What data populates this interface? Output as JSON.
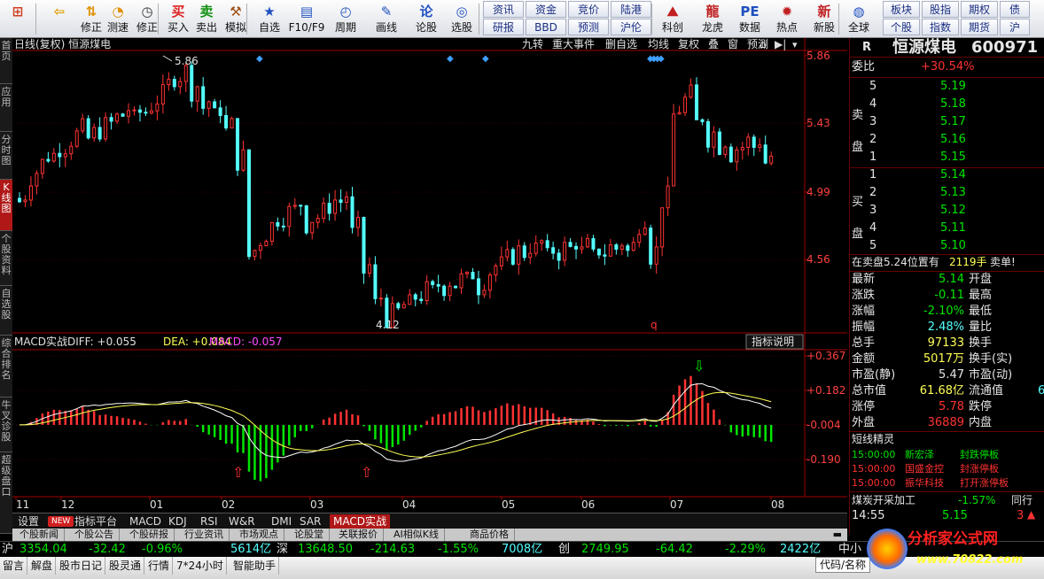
{
  "toolbar": {
    "buttons": [
      {
        "label": "",
        "icon": "home-icon",
        "color": "#d04020"
      },
      {
        "label": "",
        "icon": "back-arrow-icon",
        "color": "#e0a000"
      },
      {
        "label": "修正",
        "icon": "up-down-arrow-icon",
        "color": "#e09000"
      },
      {
        "label": "测速",
        "icon": "speed-dial-icon",
        "color": "#e09000"
      },
      {
        "label": "修正",
        "icon": "clock-icon",
        "color": "#333"
      },
      {
        "label": "买入",
        "icon": "buy-icon",
        "color": "#e02020"
      },
      {
        "label": "卖出",
        "icon": "sell-icon",
        "color": "#109010"
      },
      {
        "label": "模拟",
        "icon": "hammer-icon",
        "color": "#a05010"
      },
      {
        "label": "自选",
        "icon": "star-icon",
        "color": "#2050c0"
      },
      {
        "label": "F10/F9",
        "icon": "f10-icon",
        "color": "#2050c0"
      },
      {
        "label": "周期",
        "icon": "clock-cycle-icon",
        "color": "#2050c0"
      },
      {
        "label": "画线",
        "icon": "pen-icon",
        "color": "#2050c0"
      },
      {
        "label": "论股",
        "icon": "discuss-icon",
        "color": "#2050c0"
      },
      {
        "label": "选股",
        "icon": "stock-picker-icon",
        "color": "#2050c0"
      },
      {
        "label": "科创",
        "icon": "mountain-chart-icon",
        "color": "#c02020"
      },
      {
        "label": "龙虎",
        "icon": "dragon-icon",
        "color": "#c02020"
      },
      {
        "label": "数据",
        "icon": "pe-icon",
        "color": "#2050c0"
      },
      {
        "label": "热点",
        "icon": "hot-icon",
        "color": "#c02020"
      },
      {
        "label": "新股",
        "icon": "new-stock-icon",
        "color": "#c02020"
      },
      {
        "label": "全球",
        "icon": "globe-icon",
        "color": "#2050c0"
      }
    ],
    "grid": [
      [
        "资讯",
        "资金",
        "竞价",
        "陆港"
      ],
      [
        "研报",
        "BBD",
        "预测",
        "沪伦"
      ]
    ],
    "grid2": [
      [
        "板块",
        "股指",
        "期权",
        "债"
      ],
      [
        "个股",
        "指数",
        "期货",
        "沪"
      ]
    ],
    "tb_labels": {
      "revise": "修正",
      "speed": "测速",
      "fix": "修正"
    }
  },
  "lefttabs": [
    "首页",
    "应用",
    "分时图",
    "K线图",
    "个股资料",
    "自选股",
    "综合排名",
    "牛叉诊股",
    "超级盘口"
  ],
  "kline": {
    "title": "日线(复权)  恒源煤电",
    "menu": [
      "九转",
      "重大事件",
      "删自选",
      "均线",
      "复权",
      "叠",
      "窗",
      "预测"
    ],
    "high_label": "5.86",
    "low_label": "4.12",
    "marker": "q",
    "yticks": [
      "5.86",
      "5.43",
      "4.99",
      "4.56"
    ]
  },
  "macd": {
    "title": "MACD实战",
    "diff_label": "DIFF: +0.055",
    "dea_label": "DEA: +0.084",
    "macd_label": "MACD: -0.057",
    "button": "指标说明",
    "yticks": [
      "+0.367",
      "+0.182",
      "-0.004",
      "-0.190"
    ]
  },
  "xaxis": [
    "11",
    "12",
    "01",
    "02",
    "03",
    "04",
    "05",
    "06",
    "07",
    "08"
  ],
  "bottomtabs": [
    "设置",
    "NEW",
    "指标平台",
    "MACD",
    "KDJ",
    "RSI",
    "W&R",
    "DMI",
    "SAR",
    "MACD实战"
  ],
  "newstabs": [
    "个股新闻",
    "个股公告",
    "个股研报",
    "行业资讯",
    "市场观点",
    "论股堂",
    "关联报价",
    "AI相似K线",
    "商品价格"
  ],
  "right": {
    "R": "R",
    "name": "恒源煤电",
    "code": "600971",
    "weibi_label": "委比",
    "weibi": "+30.54%",
    "sell_label": "卖盘",
    "buy_label": "买盘",
    "asks": [
      [
        "5",
        "5.19"
      ],
      [
        "4",
        "5.18"
      ],
      [
        "3",
        "5.17"
      ],
      [
        "2",
        "5.16"
      ],
      [
        "1",
        "5.15"
      ]
    ],
    "bids": [
      [
        "1",
        "5.14"
      ],
      [
        "2",
        "5.13"
      ],
      [
        "3",
        "5.12"
      ],
      [
        "4",
        "5.11"
      ],
      [
        "5",
        "5.10"
      ]
    ],
    "notice": "在卖盘5.24位置有",
    "notice2": "2119手",
    "notice3": "卖单!",
    "quotes": [
      {
        "l": "最新",
        "v": "5.14",
        "c": "green",
        "l2": "开盘",
        "v2": ""
      },
      {
        "l": "涨跌",
        "v": "-0.11",
        "c": "green",
        "l2": "最高",
        "v2": ""
      },
      {
        "l": "涨幅",
        "v": "-2.10%",
        "c": "green",
        "l2": "最低",
        "v2": ""
      },
      {
        "l": "振幅",
        "v": "2.48%",
        "c": "cyan",
        "l2": "量比",
        "v2": ""
      },
      {
        "l": "总手",
        "v": "97133",
        "c": "yel",
        "l2": "换手",
        "v2": ""
      },
      {
        "l": "金额",
        "v": "5017万",
        "c": "yel",
        "l2": "换手(实)",
        "v2": ""
      },
      {
        "l": "市盈(静)",
        "v": "5.47",
        "c": "wht",
        "l2": "市盈(动)",
        "v2": ""
      },
      {
        "l": "总市值",
        "v": "61.68亿",
        "c": "yel",
        "l2": "流通值",
        "v2": "6"
      },
      {
        "l": "涨停",
        "v": "5.78",
        "c": "red",
        "l2": "跌停",
        "v2": ""
      },
      {
        "l": "外盘",
        "v": "36889",
        "c": "red",
        "l2": "内盘",
        "v2": ""
      }
    ],
    "dxjl_title": "短线精灵",
    "dxjl": [
      [
        "15:00:00",
        "新宏泽",
        "封跌停板"
      ],
      [
        "15:00:00",
        "国盛金控",
        "封涨停板"
      ],
      [
        "15:00:00",
        "振华科技",
        "打开涨停板"
      ]
    ],
    "sector_label": "煤炭开采加工",
    "sector_pct": "-1.57%",
    "sector_tab": "同行",
    "last_time": "14:55",
    "last_price": "5.15",
    "last_vol": "3"
  },
  "ticker": [
    {
      "t": "沪",
      "c": "wht"
    },
    {
      "t": "3354.04",
      "c": "green"
    },
    {
      "t": "-32.42",
      "c": "green"
    },
    {
      "t": "-0.96%",
      "c": "green"
    },
    {
      "t": "5614亿",
      "c": "cyan"
    },
    {
      "t": "深",
      "c": "wht"
    },
    {
      "t": "13648.50",
      "c": "green"
    },
    {
      "t": "-214.63",
      "c": "green"
    },
    {
      "t": "-1.55%",
      "c": "green"
    },
    {
      "t": "7008亿",
      "c": "cyan"
    },
    {
      "t": "创",
      "c": "wht"
    },
    {
      "t": "2749.95",
      "c": "green"
    },
    {
      "t": "-64.42",
      "c": "green"
    },
    {
      "t": "-2.29%",
      "c": "green"
    },
    {
      "t": "2422亿",
      "c": "cyan"
    },
    {
      "t": "中小",
      "c": "wht"
    }
  ],
  "status": [
    "留言",
    "解盘",
    "股市日记",
    "股灵通",
    "行情",
    "7*24小时",
    "智能助手"
  ],
  "status_right": "代码/名称",
  "watermark": {
    "site": "分析家公式网",
    "url": "www.70822.com"
  },
  "chart_data": {
    "type": "candlestick",
    "title": "日线(复权) 恒源煤电",
    "ylim": [
      4.12,
      5.86
    ],
    "yticks": [
      5.86,
      5.43,
      4.99,
      4.56
    ],
    "months": [
      "11",
      "12",
      "01",
      "02",
      "03",
      "04",
      "05",
      "06",
      "07",
      "08"
    ],
    "high": 5.86,
    "low": 4.12,
    "closes_est": [
      4.95,
      5.1,
      5.2,
      5.25,
      5.3,
      5.38,
      5.35,
      5.4,
      5.45,
      5.5,
      5.48,
      5.52,
      5.6,
      5.7,
      5.75,
      5.65,
      5.55,
      5.5,
      5.4,
      5.2,
      4.6,
      4.7,
      4.8,
      4.85,
      4.9,
      4.8,
      4.85,
      4.92,
      4.95,
      4.75,
      4.5,
      4.3,
      4.2,
      4.25,
      4.3,
      4.35,
      4.38,
      4.4,
      4.42,
      4.45,
      4.4,
      4.5,
      4.55,
      4.6,
      4.62,
      4.65,
      4.6,
      4.62,
      4.65,
      4.63,
      4.6,
      4.62,
      4.65,
      4.63,
      4.8,
      4.6,
      4.95,
      5.5,
      5.6,
      5.45,
      5.35,
      5.3,
      5.25,
      5.3,
      5.3,
      5.2
    ],
    "macd_ylim": [
      -0.19,
      0.367
    ]
  }
}
